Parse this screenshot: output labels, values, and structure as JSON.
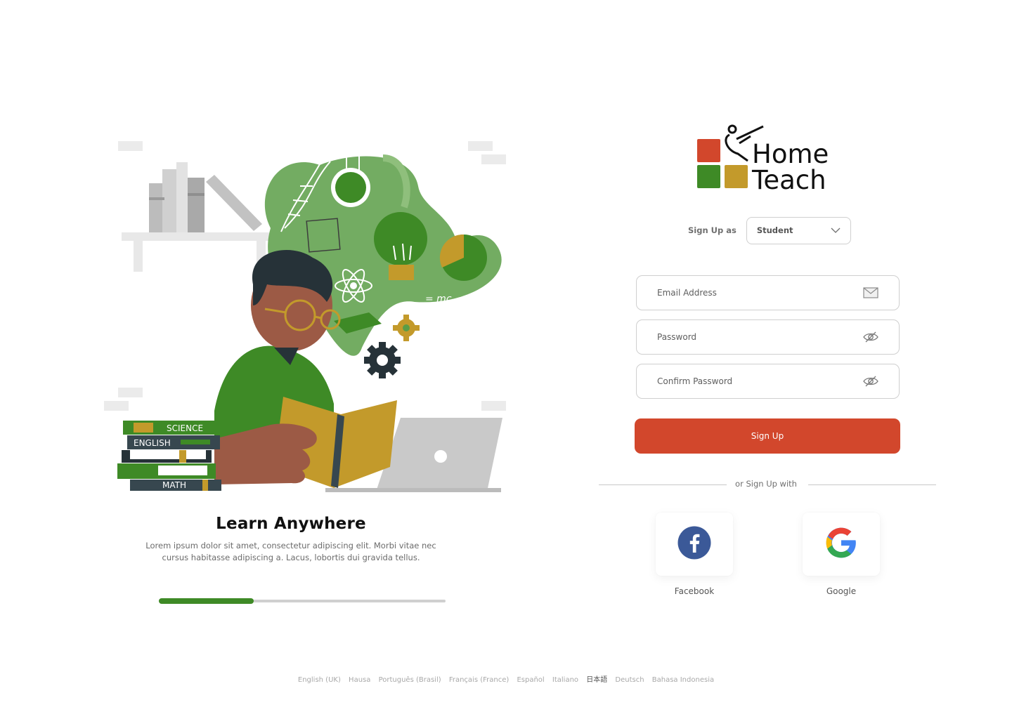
{
  "brand": {
    "line1": "Home",
    "line2": "Teach",
    "colors": {
      "red": "#d2472c",
      "green": "#3e8a26",
      "gold": "#c39a2b"
    }
  },
  "illustration": {
    "books": [
      "SCIENCE",
      "ENGLISH",
      "MATH"
    ],
    "formula": "= mc",
    "icon_names": [
      "dna-icon",
      "flask-icon",
      "lightbulb-icon",
      "atom-icon",
      "gear-icon",
      "pie-chart-icon",
      "graduation-cap-icon",
      "laptop-icon"
    ]
  },
  "onboarding": {
    "title": "Learn Anywhere",
    "text": "Lorem ipsum dolor sit amet, consectetur adipiscing elit. Morbi vitae nec cursus habitasse adipiscing a. Lacus, lobortis dui gravida tellus.",
    "progress": 0.33
  },
  "form": {
    "signup_as_label": "Sign Up as",
    "role": "Student",
    "email_placeholder": "Email Address",
    "password_placeholder": "Password",
    "confirm_placeholder": "Confirm Password",
    "submit_label": "Sign Up",
    "or_text": "or Sign Up with",
    "icons": {
      "email": "mail-icon",
      "password": "eye-off-icon",
      "confirm": "eye-off-icon",
      "role": "chevron-down-icon"
    }
  },
  "social": [
    {
      "label": "Facebook",
      "icon": "facebook-icon",
      "color": "#3b5998"
    },
    {
      "label": "Google",
      "icon": "google-icon"
    }
  ],
  "languages": {
    "items": [
      "English (UK)",
      "Hausa",
      "Português (Brasil)",
      "Français (France)",
      "Español",
      "Italiano",
      "日本語",
      "Deutsch",
      "Bahasa Indonesia"
    ],
    "selected": "日本語"
  }
}
